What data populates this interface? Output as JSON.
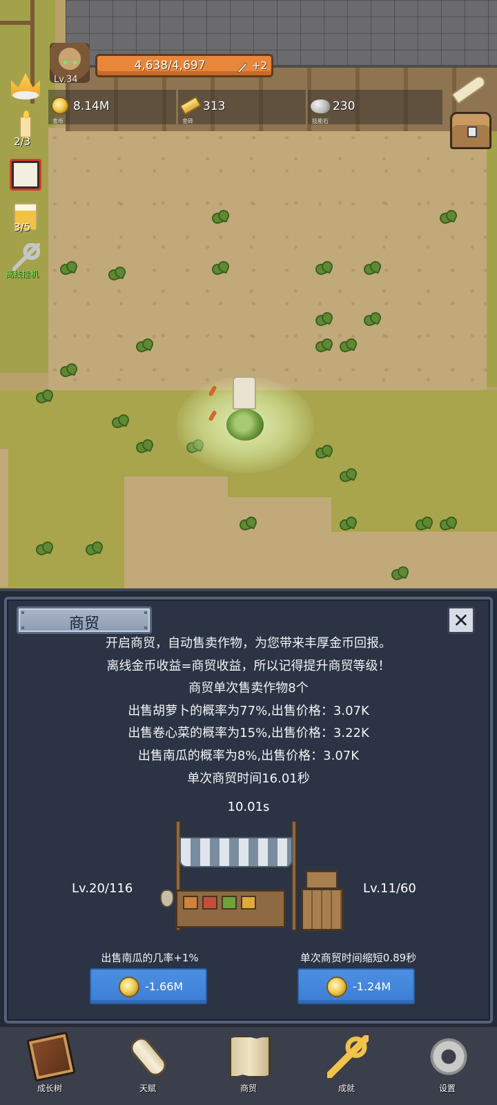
{
  "hud": {
    "level": "Lv.34",
    "hp": "4,638/4,697",
    "hp_bonus": "+2",
    "coins_value": "8.14M",
    "coins_label": "金币",
    "gold_value": "313",
    "gold_label": "金砖",
    "stone_value": "230",
    "stone_label": "技能石"
  },
  "side": {
    "candle_count": "2/3",
    "beer_count": "3/5",
    "offline_label": "离线挂机"
  },
  "panel": {
    "title": "商贸",
    "close_symbol": "✕",
    "desc": [
      "开启商贸，自动售卖作物，为您带来丰厚金币回报。",
      "离线金币收益=商贸收益，所以记得提升商贸等级！",
      "商贸单次售卖作物8个",
      "出售胡萝卜的概率为77%,出售价格：3.07K",
      "出售卷心菜的概率为15%,出售价格：3.22K",
      "出售南瓜的概率为8%,出售价格：3.07K",
      "单次商贸时间16.01秒"
    ],
    "timer": "10.01s",
    "left_level": "Lv.20/116",
    "right_level": "Lv.11/60",
    "left_upgrade_label": "出售南瓜的几率+1%",
    "right_upgrade_label": "单次商贸时间缩短0.89秒",
    "left_cost": "-1.66M",
    "right_cost": "-1.24M"
  },
  "nav": {
    "growth_tree": "成长树",
    "talent": "天赋",
    "trade": "商贸",
    "achievements": "成就",
    "settings": "设置"
  },
  "colors": {
    "panel_bg": "#2b3344",
    "upgrade_button": "#4b8fe2",
    "hp_bar": "#e8873a",
    "nav_bg": "#3a3f4b"
  }
}
